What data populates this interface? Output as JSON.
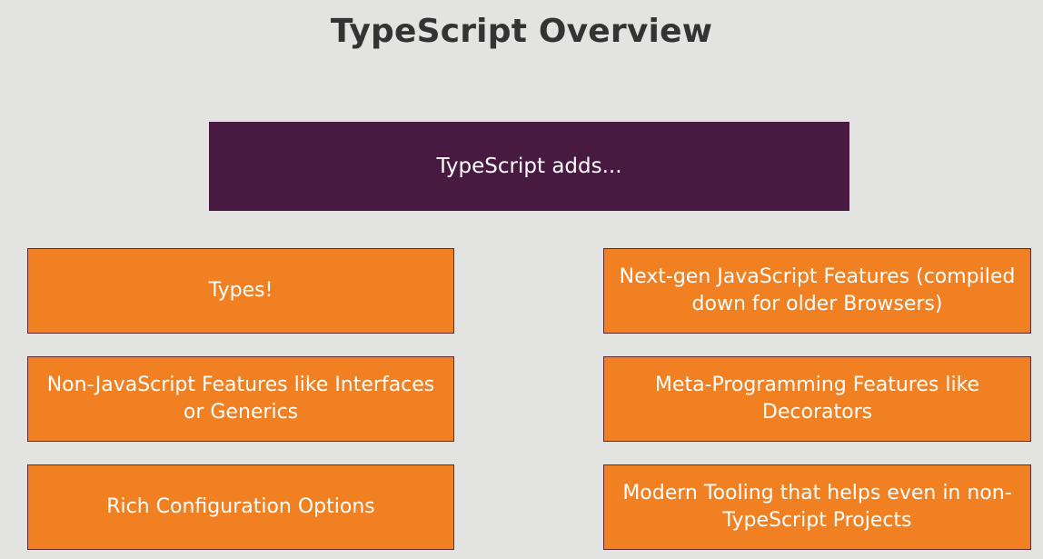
{
  "slide": {
    "title": "TypeScript Overview",
    "header": "TypeScript adds...",
    "features_left": [
      "Types!",
      "Non-JavaScript Features like Interfaces or Generics",
      "Rich Configuration Options"
    ],
    "features_right": [
      "Next-gen JavaScript Features (compiled down for older Browsers)",
      "Meta-Programming Features like Decorators",
      "Modern Tooling that helps even in non-TypeScript Projects"
    ]
  },
  "colors": {
    "background": "#e3e3e2",
    "header": "#481a42",
    "feature_box": "#f08021",
    "title_text": "#333333"
  }
}
